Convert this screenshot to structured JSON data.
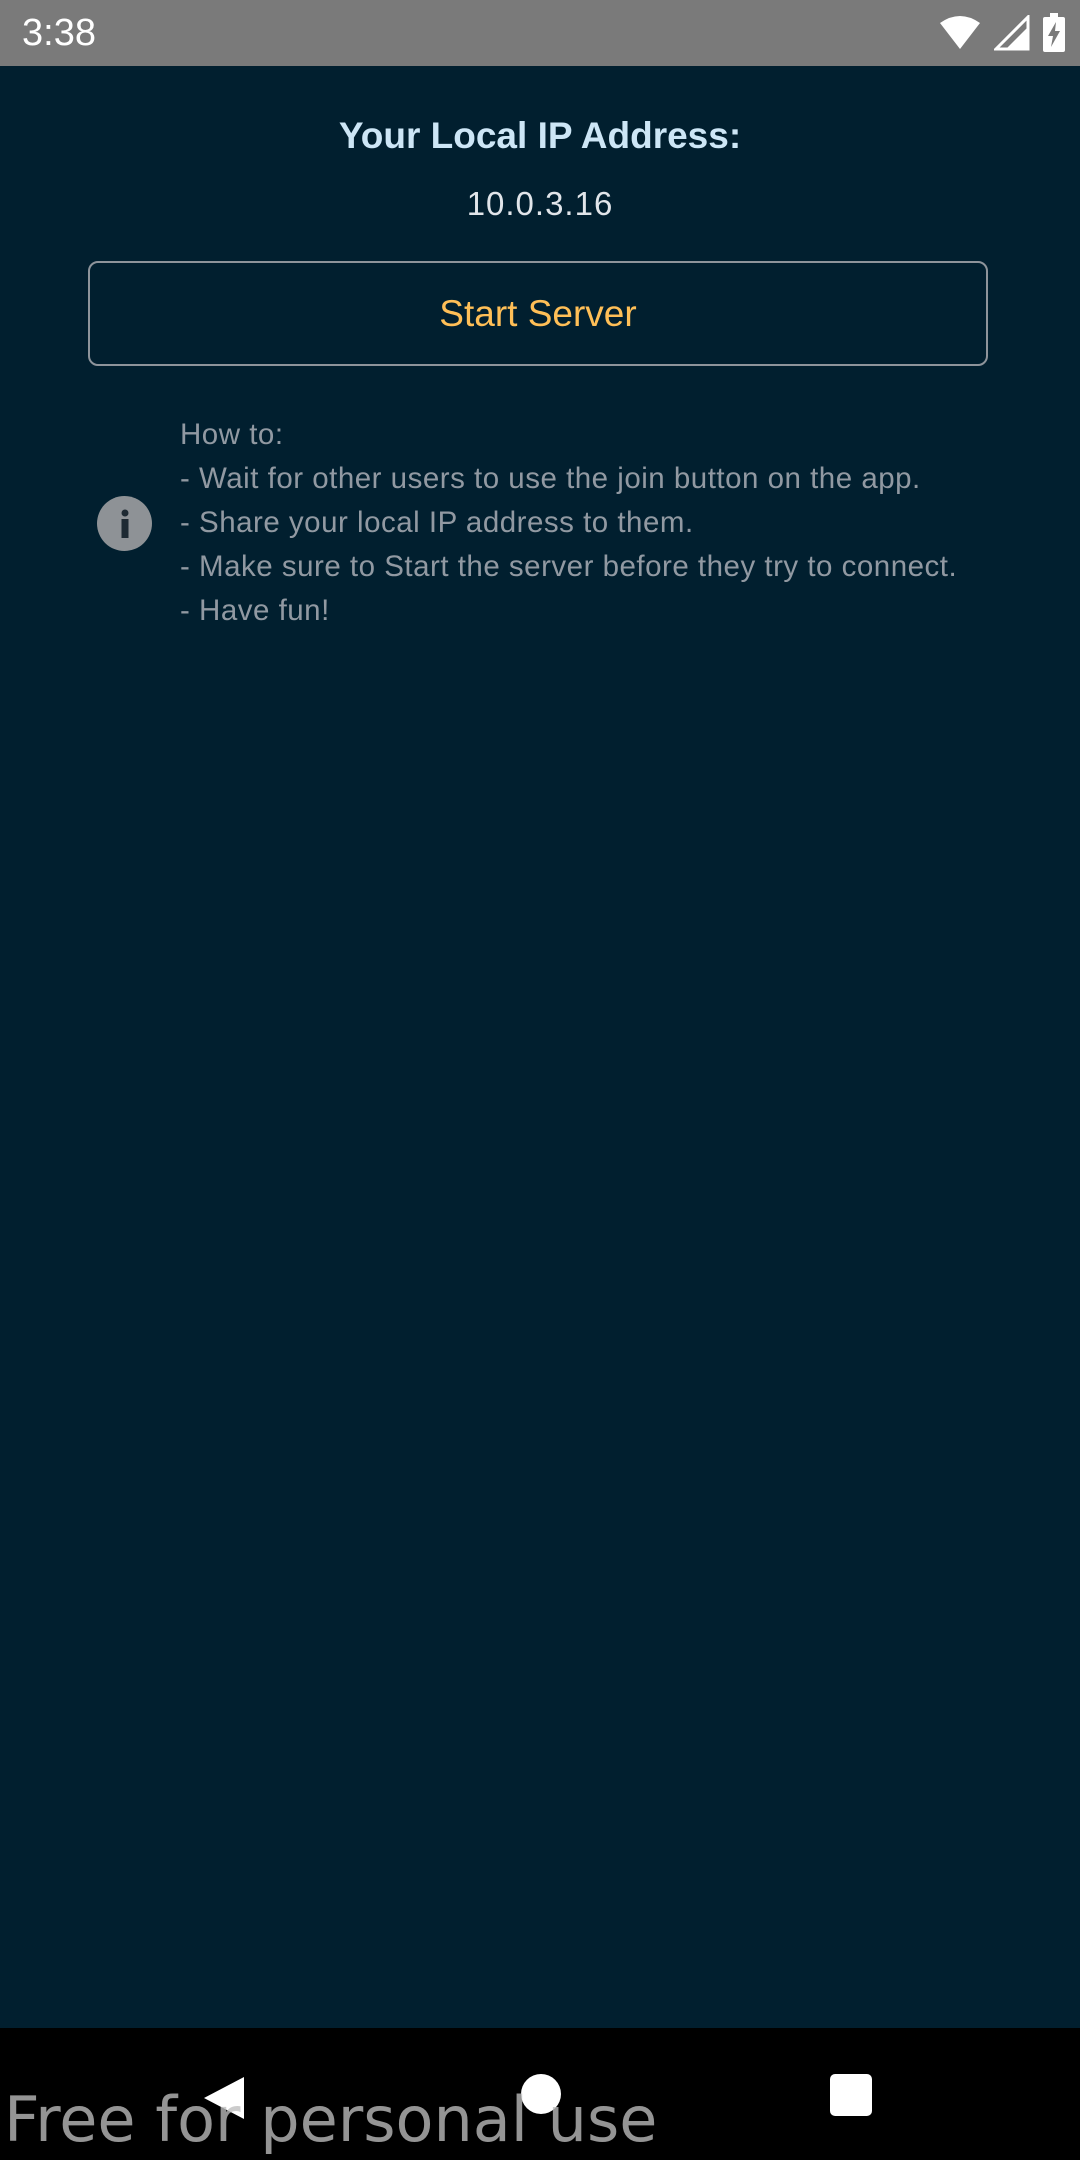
{
  "status_bar": {
    "time": "3:38",
    "icons": [
      "wifi-icon",
      "cellular-signal-icon",
      "battery-charging-icon"
    ]
  },
  "main": {
    "ip_heading": "Your Local IP Address:",
    "ip_value": "10.0.3.16",
    "start_button_label": "Start Server",
    "info_icon": "info-icon",
    "howto_lines": [
      "How to:",
      "- Wait for other users to use the join button on the app.",
      "- Share your local IP address to them.",
      "- Make sure to Start the server before they try to connect.",
      "- Have fun!"
    ]
  },
  "nav_bar": {
    "icons": [
      "back-icon",
      "home-icon",
      "recents-icon"
    ]
  },
  "watermark": "Free for personal use",
  "colors": {
    "background": "#011F2F",
    "status_bar": "#7A7A7A",
    "heading": "#CDE6F6",
    "button_text": "#FFBF57",
    "button_border": "#8E949B",
    "howto_text": "#9199A2"
  }
}
